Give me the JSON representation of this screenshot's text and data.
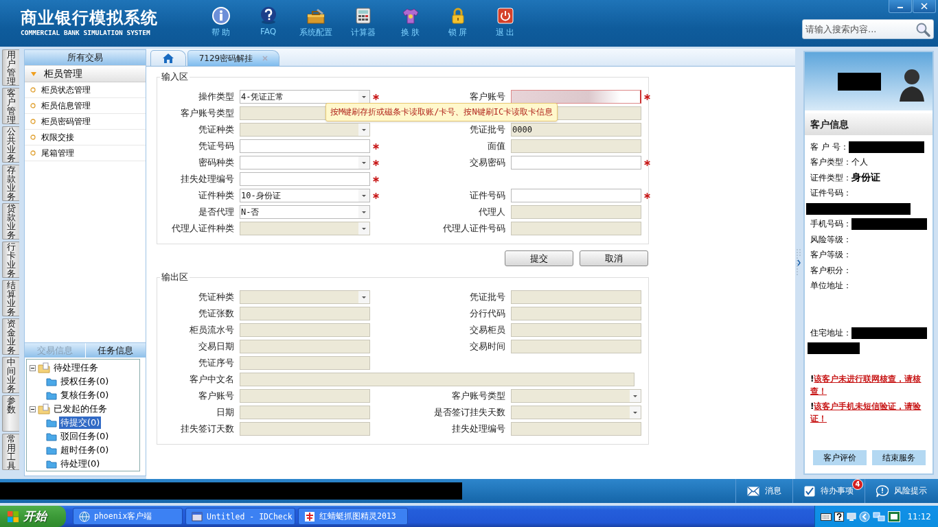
{
  "app": {
    "title": "商业银行模拟系统",
    "subtitle": "COMMERCIAL BANK SIMULATION SYSTEM"
  },
  "toolbar": [
    {
      "kind": "info",
      "label": "帮 助"
    },
    {
      "kind": "faq",
      "label": "FAQ"
    },
    {
      "kind": "toolbox",
      "label": "系统配置"
    },
    {
      "kind": "calculator",
      "label": "计算器"
    },
    {
      "kind": "skin",
      "label": "换 肤"
    },
    {
      "kind": "lock",
      "label": "锁 屏"
    },
    {
      "kind": "power",
      "label": "退 出"
    }
  ],
  "search": {
    "placeholder": "请输入搜索内容..."
  },
  "side_tabs": [
    "用户管理",
    "客户管理",
    "公共业务",
    "存款业务",
    "贷款业务",
    "行卡业务",
    "结算业务",
    "资金业务",
    "中间业务",
    "参数",
    "常用工具"
  ],
  "menu": {
    "header": "所有交易",
    "group": {
      "label": "柜员管理",
      "expanded": true
    },
    "items": [
      "柜员状态管理",
      "柜员信息管理",
      "柜员密码管理",
      "权限交接",
      "尾箱管理"
    ]
  },
  "task_tabs": [
    {
      "label": "交易信息",
      "selected": false
    },
    {
      "label": "任务信息",
      "selected": true
    }
  ],
  "task_tree": [
    {
      "label": "待处理任务",
      "expanded": true,
      "children": [
        {
          "label": "授权任务(0)",
          "selected": false
        },
        {
          "label": "复核任务(0)",
          "selected": false
        }
      ]
    },
    {
      "label": "已发起的任务",
      "expanded": true,
      "children": [
        {
          "label": "待提交(0)",
          "selected": true
        },
        {
          "label": "驳回任务(0)",
          "selected": false
        },
        {
          "label": "超时任务(0)",
          "selected": false
        },
        {
          "label": "待处理(0)",
          "selected": false
        }
      ]
    }
  ],
  "tabs": [
    {
      "kind": "home",
      "selected": false
    },
    {
      "kind": "page",
      "label": "7129密码解挂",
      "selected": true
    }
  ],
  "input_section": {
    "title": "输入区",
    "rows": [
      {
        "left": {
          "label": "操作类型",
          "kind": "select",
          "value": "4-凭证正常",
          "disabled": false,
          "required": true
        },
        "right": {
          "label": "客户账号",
          "kind": "masked",
          "disabled": false,
          "required": true
        }
      },
      {
        "left": {
          "label": "客户账号类型",
          "kind": "text",
          "disabled": true,
          "required": false
        },
        "right": {
          "kind": "text",
          "disabled": true,
          "required": false
        }
      },
      {
        "left": {
          "label": "凭证种类",
          "kind": "select",
          "disabled": true,
          "required": false
        },
        "right": {
          "label": "凭证批号",
          "kind": "text",
          "value": "0000",
          "disabled": true,
          "required": false
        }
      },
      {
        "left": {
          "label": "凭证号码",
          "kind": "text",
          "disabled": false,
          "required": true
        },
        "right": {
          "label": "面值",
          "kind": "text",
          "disabled": true,
          "required": false
        }
      },
      {
        "left": {
          "label": "密码种类",
          "kind": "select",
          "disabled": false,
          "required": true
        },
        "right": {
          "label": "交易密码",
          "kind": "text",
          "disabled": false,
          "required": true
        }
      },
      {
        "left": {
          "label": "挂失处理编号",
          "kind": "text",
          "disabled": false,
          "required": true
        }
      },
      {
        "left": {
          "label": "证件种类",
          "kind": "select",
          "value": "10-身份证",
          "disabled": false,
          "required": true
        },
        "right": {
          "label": "证件号码",
          "kind": "text",
          "disabled": false,
          "required": true
        }
      },
      {
        "left": {
          "label": "是否代理",
          "kind": "select",
          "value": "N-否",
          "disabled": false,
          "required": false
        },
        "right": {
          "label": "代理人",
          "kind": "text",
          "disabled": true,
          "required": false
        }
      },
      {
        "left": {
          "label": "代理人证件种类",
          "kind": "select",
          "disabled": true,
          "required": false
        },
        "right": {
          "label": "代理人证件号码",
          "kind": "text",
          "disabled": true,
          "required": false
        }
      }
    ]
  },
  "tooltip": "按M键刷存折或磁条卡读取账/卡号、按N键刷IC卡读取卡信息",
  "buttons": [
    "提交",
    "取消"
  ],
  "output_section": {
    "title": "输出区",
    "rows": [
      {
        "left": {
          "label": "凭证种类",
          "kind": "select",
          "disabled": true,
          "required": false
        },
        "right": {
          "label": "凭证批号",
          "kind": "text",
          "disabled": true,
          "required": false
        }
      },
      {
        "left": {
          "label": "凭证张数",
          "kind": "text",
          "disabled": true,
          "required": false
        },
        "right": {
          "label": "分行代码",
          "kind": "text",
          "disabled": true,
          "required": false
        }
      },
      {
        "left": {
          "label": "柜员流水号",
          "kind": "text",
          "disabled": true,
          "required": false
        },
        "right": {
          "label": "交易柜员",
          "kind": "text",
          "disabled": true,
          "required": false
        }
      },
      {
        "left": {
          "label": "交易日期",
          "kind": "text",
          "disabled": true,
          "required": false
        },
        "right": {
          "label": "交易时间",
          "kind": "text",
          "disabled": true,
          "required": false
        }
      },
      {
        "left": {
          "label": "凭证序号",
          "kind": "text",
          "disabled": true,
          "required": false
        }
      },
      {
        "full": {
          "label": "客户中文名",
          "kind": "text",
          "disabled": true,
          "required": false
        }
      },
      {
        "left": {
          "label": "客户账号",
          "kind": "text",
          "disabled": true,
          "required": false
        },
        "right": {
          "label": "客户账号类型",
          "kind": "select",
          "disabled": true,
          "required": false
        }
      },
      {
        "left": {
          "label": "日期",
          "kind": "text",
          "disabled": true,
          "required": false
        },
        "right": {
          "label": "是否签订挂失天数",
          "kind": "select",
          "disabled": true,
          "required": false
        }
      },
      {
        "left": {
          "label": "挂失签订天数",
          "kind": "text",
          "disabled": true,
          "required": false
        },
        "right": {
          "label": "挂失处理编号",
          "kind": "text",
          "disabled": true,
          "required": false
        }
      }
    ]
  },
  "customer": {
    "title": "客户信息",
    "fields": [
      {
        "label": "客 户 号：",
        "kind": "redacted"
      },
      {
        "label": "客户类型：",
        "kind": "text",
        "value": "个人"
      },
      {
        "label": "证件类型：",
        "kind": "emphasis",
        "value": "身份证"
      },
      {
        "label": "证件号码：",
        "kind": "redacted_below"
      },
      {
        "label": "手机号码：",
        "kind": "redacted"
      },
      {
        "label": "风险等级：",
        "kind": "empty"
      },
      {
        "label": "客户等级：",
        "kind": "empty"
      },
      {
        "label": "客户积分：",
        "kind": "empty"
      },
      {
        "label": "单位地址：",
        "kind": "empty_block"
      },
      {
        "label": "住宅地址：",
        "kind": "redacted_wrap"
      }
    ],
    "warnings": [
      {
        "mark": "!",
        "text": "该客户未进行联网核查，请核查！"
      },
      {
        "mark": "!",
        "text": "该客户手机未短信验证，请验证！"
      }
    ],
    "buttons": [
      "客户评价",
      "结束服务"
    ]
  },
  "status_bar": [
    {
      "kind": "message",
      "label": "消息"
    },
    {
      "kind": "todo",
      "label": "待办事项",
      "badge": "4"
    },
    {
      "kind": "risk",
      "label": "风险提示"
    }
  ],
  "taskbar": {
    "start": "开始",
    "tasks": [
      {
        "kind": "browser",
        "label": "phoenix客户端"
      },
      {
        "kind": "window",
        "label": "Untitled - IDCheck"
      },
      {
        "kind": "capture",
        "label": "红蜻蜓抓图精灵2013"
      }
    ],
    "clock": "11:12"
  }
}
